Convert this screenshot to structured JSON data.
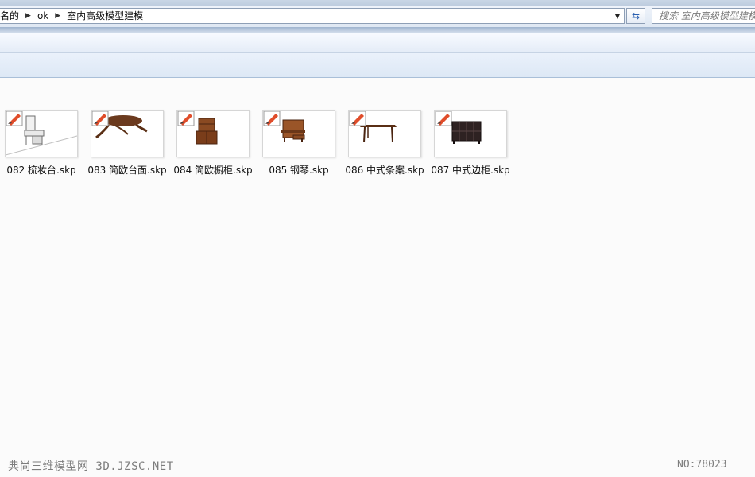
{
  "address": {
    "crumbs": [
      "名的",
      "ok",
      "室内高级模型建模"
    ]
  },
  "search": {
    "placeholder": "搜索 室内高级模型建模"
  },
  "files": [
    {
      "name": "082 梳妆台.skp",
      "thumbnail": "dressing-table"
    },
    {
      "name": "083 简欧台面.skp",
      "thumbnail": "oval-table"
    },
    {
      "name": "084 简欧橱柜.skp",
      "thumbnail": "cupboard"
    },
    {
      "name": "085 钢琴.skp",
      "thumbnail": "piano"
    },
    {
      "name": "086 中式条案.skp",
      "thumbnail": "long-table"
    },
    {
      "name": "087 中式边柜.skp",
      "thumbnail": "side-cabinet"
    }
  ],
  "watermark": {
    "left": "典尚三维模型网 3D.JZSC.NET",
    "right": "NO:78023"
  },
  "colors": {
    "window_chrome": "#dfe8f3",
    "accent_border": "#8e9fb6",
    "content_bg": "#fbfbfb"
  }
}
